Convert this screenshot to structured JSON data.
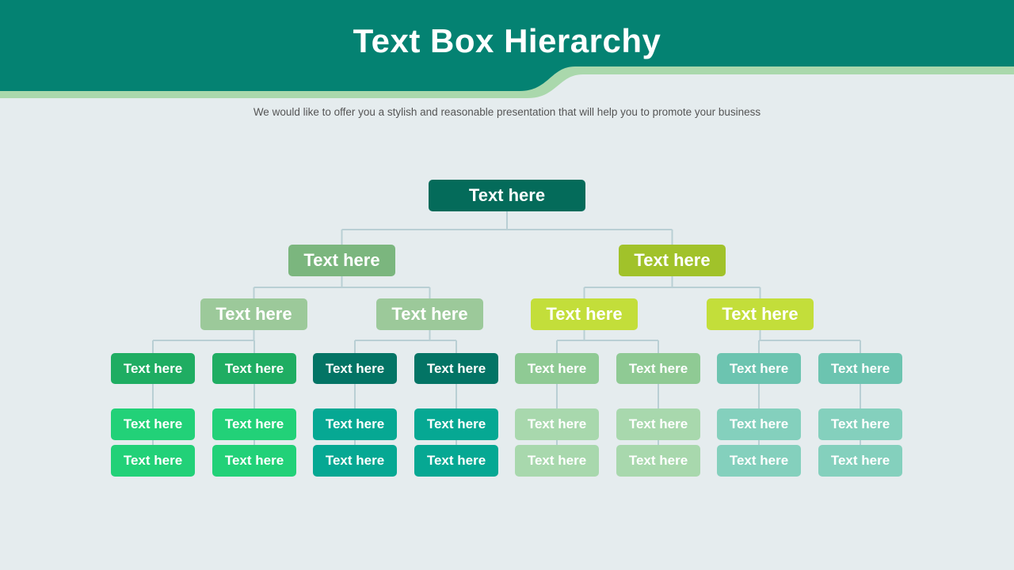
{
  "header": {
    "title": "Text Box Hierarchy",
    "subtitle": "We would like to offer you a stylish and reasonable presentation that will help you to promote your business"
  },
  "colors": {
    "background": "#e5ecee",
    "header": "#048272",
    "header_accent": "#aad8ac",
    "connector": "#b9cfd4"
  },
  "hierarchy": {
    "root": {
      "label": "Text here",
      "color": "#046b5a"
    },
    "level1": [
      {
        "label": "Text here",
        "color": "#7bb67e"
      },
      {
        "label": "Text here",
        "color": "#a1c22a"
      }
    ],
    "level2": [
      {
        "label": "Text here",
        "color": "#9cc99a"
      },
      {
        "label": "Text here",
        "color": "#9cc99a"
      },
      {
        "label": "Text here",
        "color": "#c3de3a"
      },
      {
        "label": "Text here",
        "color": "#c3de3a"
      }
    ],
    "level3": [
      {
        "label": "Text here",
        "color": "#1fad62"
      },
      {
        "label": "Text here",
        "color": "#1fad62"
      },
      {
        "label": "Text here",
        "color": "#037465"
      },
      {
        "label": "Text here",
        "color": "#037465"
      },
      {
        "label": "Text here",
        "color": "#8fca94"
      },
      {
        "label": "Text here",
        "color": "#8fca94"
      },
      {
        "label": "Text here",
        "color": "#6cc4b0"
      },
      {
        "label": "Text here",
        "color": "#6cc4b0"
      }
    ],
    "level4": [
      {
        "label": "Text here",
        "color": "#22d178"
      },
      {
        "label": "Text here",
        "color": "#22d178"
      },
      {
        "label": "Text here",
        "color": "#06a893"
      },
      {
        "label": "Text here",
        "color": "#06a893"
      },
      {
        "label": "Text here",
        "color": "#a8d8ad"
      },
      {
        "label": "Text here",
        "color": "#a8d8ad"
      },
      {
        "label": "Text here",
        "color": "#84d0bd"
      },
      {
        "label": "Text here",
        "color": "#84d0bd"
      }
    ],
    "level5": [
      {
        "label": "Text here",
        "color": "#22d178"
      },
      {
        "label": "Text here",
        "color": "#22d178"
      },
      {
        "label": "Text here",
        "color": "#06a893"
      },
      {
        "label": "Text here",
        "color": "#06a893"
      },
      {
        "label": "Text here",
        "color": "#a8d8ad"
      },
      {
        "label": "Text here",
        "color": "#a8d8ad"
      },
      {
        "label": "Text here",
        "color": "#84d0bd"
      },
      {
        "label": "Text here",
        "color": "#84d0bd"
      }
    ]
  }
}
